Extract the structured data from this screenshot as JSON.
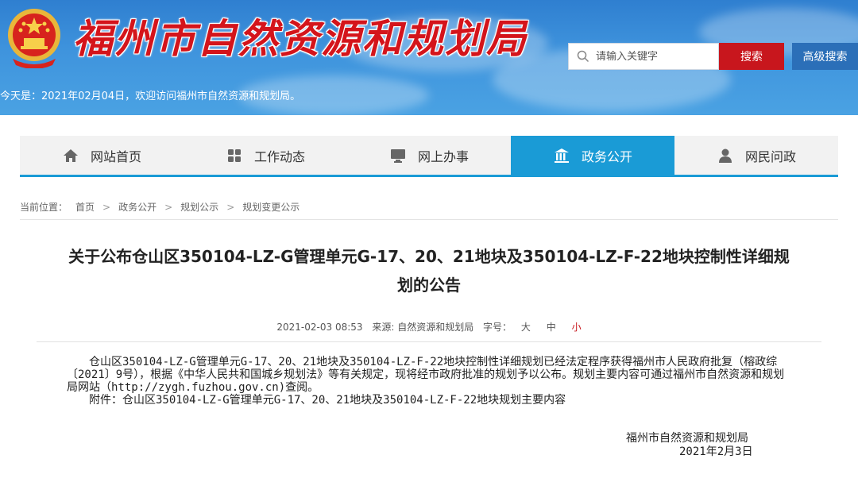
{
  "header": {
    "site_title": "福州市自然资源和规划局",
    "search_placeholder": "请输入关键字",
    "search_button": "搜索",
    "advanced_search": "高级搜索",
    "date_line": "今天是：2021年02月04日，欢迎访问福州市自然资源和规划局。",
    "colors": {
      "banner": "#3f94dd",
      "title": "#d4141b",
      "search_button": "#c8161d"
    }
  },
  "nav": {
    "items": [
      {
        "label": "网站首页",
        "icon": "home-icon"
      },
      {
        "label": "工作动态",
        "icon": "grid-icon"
      },
      {
        "label": "网上办事",
        "icon": "monitor-icon"
      },
      {
        "label": "政务公开",
        "icon": "building-icon",
        "active": true
      },
      {
        "label": "网民问政",
        "icon": "user-icon"
      }
    ],
    "active_color": "#1a9bd6"
  },
  "breadcrumb": {
    "prefix": "当前位置：",
    "items": [
      "首页",
      "政务公开",
      "规划公示",
      "规划变更公示"
    ]
  },
  "article": {
    "title_line1": "关于公布仓山区350104-LZ-G管理单元G-17、20、21地块及350104-LZ-F-22地块控制性详细规",
    "title_line2": "划的公告",
    "meta": {
      "datetime": "2021-02-03 08:53",
      "source": "来源: 自然资源和规划局",
      "font_label": "字号：",
      "font_large": "大",
      "font_medium": "中",
      "font_small": "小"
    },
    "paragraph1": "仓山区350104-LZ-G管理单元G-17、20、21地块及350104-LZ-F-22地块控制性详细规划已经法定程序获得福州市人民政府批复（榕政综〔2021〕9号），根据《中华人民共和国城乡规划法》等有关规定，现将经市政府批准的规划予以公布。规划主要内容可通过福州市自然资源和规划局网站（http://zygh.fuzhou.gov.cn)查阅。",
    "paragraph2": "附件：仓山区350104-LZ-G管理单元G-17、20、21地块及350104-LZ-F-22地块规划主要内容",
    "signature_org": "福州市自然资源和规划局",
    "signature_date": "2021年2月3日"
  }
}
